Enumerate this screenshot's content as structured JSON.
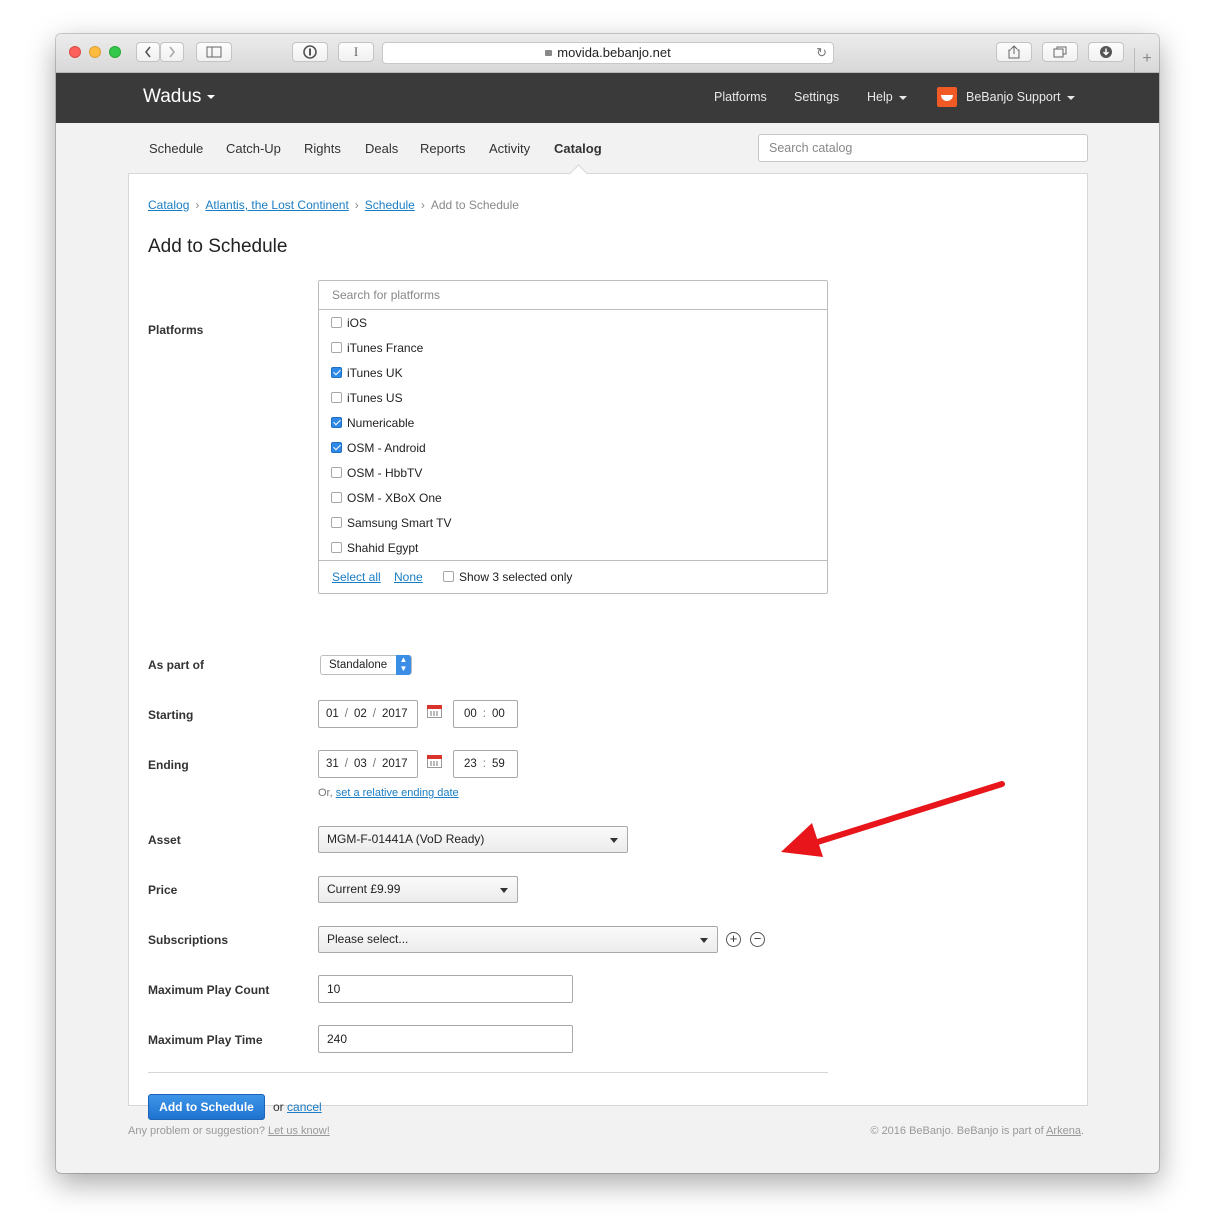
{
  "browser": {
    "url": "movida.bebanjo.net",
    "back_icon": "chevron-left-icon",
    "forward_icon": "chevron-right-icon",
    "sidebar_icon": "sidebar-icon",
    "password_icon": "1password-icon",
    "reader_label": "I",
    "share_icon": "share-icon",
    "tabs_icon": "tabs-icon",
    "download_icon": "download-icon",
    "new_tab_label": "+"
  },
  "header": {
    "brand": "Wadus",
    "nav": [
      "Platforms",
      "Settings",
      "Help"
    ],
    "user": "BeBanjo Support"
  },
  "subnav": {
    "items": [
      "Schedule",
      "Catch-Up",
      "Rights",
      "Deals",
      "Reports",
      "Activity",
      "Catalog"
    ],
    "active": "Catalog",
    "search_placeholder": "Search catalog"
  },
  "breadcrumb": {
    "items": [
      "Catalog",
      "Atlantis, the Lost Continent",
      "Schedule"
    ],
    "current": "Add to Schedule"
  },
  "page_title": "Add to Schedule",
  "form": {
    "platforms": {
      "label": "Platforms",
      "search_placeholder": "Search for platforms",
      "options": [
        {
          "name": "iOS",
          "checked": false
        },
        {
          "name": "iTunes France",
          "checked": false
        },
        {
          "name": "iTunes UK",
          "checked": true
        },
        {
          "name": "iTunes US",
          "checked": false
        },
        {
          "name": "Numericable",
          "checked": true
        },
        {
          "name": "OSM - Android",
          "checked": true
        },
        {
          "name": "OSM - HbbTV",
          "checked": false
        },
        {
          "name": "OSM - XBoX One",
          "checked": false
        },
        {
          "name": "Samsung Smart TV",
          "checked": false
        },
        {
          "name": "Shahid Egypt",
          "checked": false
        }
      ],
      "select_all": "Select all",
      "none": "None",
      "show_selected": "Show 3 selected only"
    },
    "as_part_of": {
      "label": "As part of",
      "value": "Standalone"
    },
    "starting": {
      "label": "Starting",
      "day": "01",
      "month": "02",
      "year": "2017",
      "hour": "00",
      "minute": "00"
    },
    "ending": {
      "label": "Ending",
      "day": "31",
      "month": "03",
      "year": "2017",
      "hour": "23",
      "minute": "59",
      "or_text": "Or,",
      "relative_link": "set a relative ending date"
    },
    "asset": {
      "label": "Asset",
      "value": "MGM-F-01441A (VoD Ready)"
    },
    "price": {
      "label": "Price",
      "value": "Current £9.99"
    },
    "subscriptions": {
      "label": "Subscriptions",
      "value": "Please select...",
      "add_label": "+",
      "remove_label": "−"
    },
    "max_play_count": {
      "label": "Maximum Play Count",
      "value": "10"
    },
    "max_play_time": {
      "label": "Maximum Play Time",
      "value": "240"
    },
    "submit_label": "Add to Schedule",
    "or_text": "or",
    "cancel_label": "cancel"
  },
  "footer": {
    "left_text": "Any problem or suggestion?",
    "left_link": "Let us know!",
    "right_text": "© 2016 BeBanjo. BeBanjo is part of",
    "right_link": "Arkena",
    "right_end": "."
  },
  "annotation": {
    "arrow_color": "#e8161b"
  }
}
